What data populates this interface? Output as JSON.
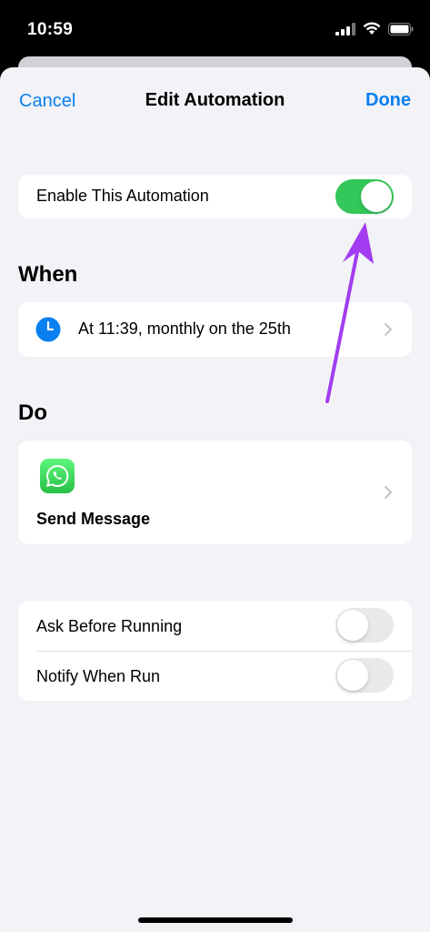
{
  "status_bar": {
    "time": "10:59",
    "icons": [
      "cellular-signal-icon",
      "wifi-icon",
      "battery-icon"
    ]
  },
  "nav": {
    "cancel_label": "Cancel",
    "title": "Edit Automation",
    "done_label": "Done"
  },
  "enable_row": {
    "label": "Enable This Automation",
    "enabled": true
  },
  "when": {
    "section_title": "When",
    "trigger_label": "At 11:39, monthly on the 25th",
    "icon": "clock-icon"
  },
  "do": {
    "section_title": "Do",
    "action_label": "Send Message",
    "app_icon": "whatsapp-icon"
  },
  "options": [
    {
      "label": "Ask Before Running",
      "enabled": false
    },
    {
      "label": "Notify When Run",
      "enabled": false
    }
  ],
  "colors": {
    "accent": "#0a7ff0",
    "toggle_on": "#34c759",
    "toggle_off": "#e9e9ea",
    "background": "#f2f2f7",
    "annotation_arrow": "#a23cf0",
    "whatsapp_green": "#25d366"
  }
}
